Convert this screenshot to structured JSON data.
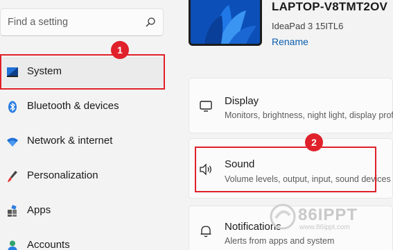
{
  "search": {
    "placeholder": "Find a setting"
  },
  "nav": {
    "items": [
      {
        "label": "System",
        "icon": "system-icon"
      },
      {
        "label": "Bluetooth & devices",
        "icon": "bluetooth-icon"
      },
      {
        "label": "Network & internet",
        "icon": "wifi-icon"
      },
      {
        "label": "Personalization",
        "icon": "brush-icon"
      },
      {
        "label": "Apps",
        "icon": "apps-icon"
      },
      {
        "label": "Accounts",
        "icon": "person-icon"
      }
    ]
  },
  "device": {
    "name": "LAPTOP-V8TMT2OV",
    "model": "IdeaPad 3 15ITL6",
    "rename_label": "Rename"
  },
  "cards": [
    {
      "title": "Display",
      "subtitle": "Monitors, brightness, night light, display profile",
      "icon": "monitor-icon"
    },
    {
      "title": "Sound",
      "subtitle": "Volume levels, output, input, sound devices",
      "icon": "speaker-icon"
    },
    {
      "title": "Notifications",
      "subtitle": "Alerts from apps and system",
      "icon": "bell-icon"
    }
  ],
  "annotations": {
    "step1": "1",
    "step2": "2"
  },
  "watermark": {
    "logo": "86IPPT",
    "url": "www.86ippt.com"
  },
  "colors": {
    "accent": "#0b5cad",
    "highlight": "#e0202a",
    "background": "#f3f3f3"
  }
}
